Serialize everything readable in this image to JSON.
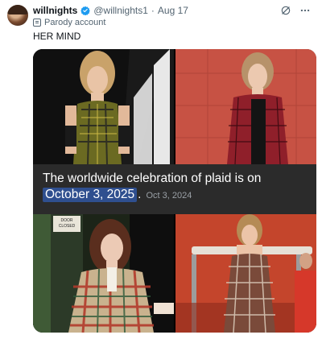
{
  "post": {
    "author_name": "willnights",
    "handle": "@willnights1",
    "separator": "·",
    "date": "Aug 17",
    "account_label": "Parody account",
    "text": "HER MIND"
  },
  "media": {
    "caption_line1": "The worldwide celebration of plaid is on",
    "caption_highlight": "October 3, 2025",
    "caption_period": ".",
    "caption_date": "Oct 3, 2024",
    "door_sign": "DOOR CLOSED"
  },
  "icons": {
    "verified": "verified-badge-icon",
    "grok": "grok-icon",
    "more": "more-icon"
  },
  "colors": {
    "verified_blue": "#1d9bf0",
    "caption_band": "#2b2b2b",
    "highlight": "#2f4f8f"
  }
}
